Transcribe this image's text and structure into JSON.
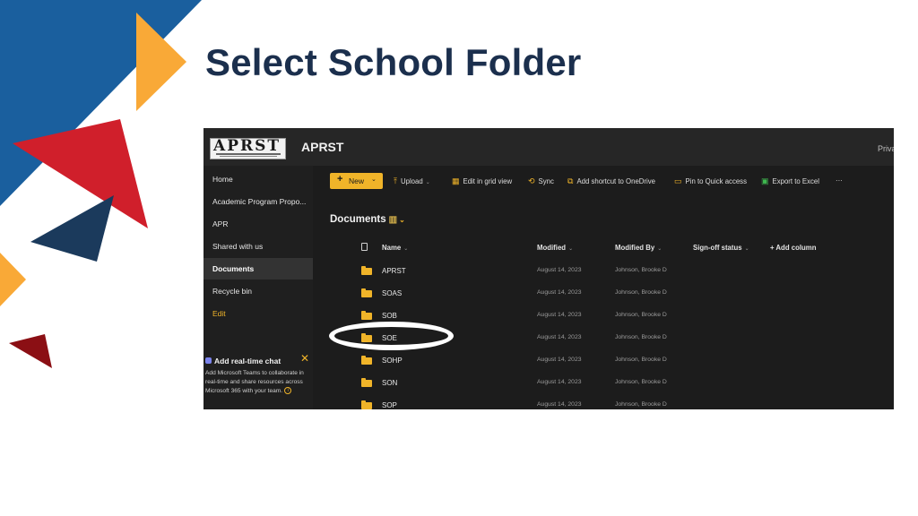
{
  "slide": {
    "title": "Select School Folder"
  },
  "colors": {
    "title": "#1b2f4d",
    "blue": "#1a5f9e",
    "orange": "#f9a937",
    "red": "#d01f2b",
    "navy": "#1b3a5c",
    "dark_red": "#8b0f14",
    "sp_background": "#1c1c1c",
    "accent_yellow": "#f0b429"
  },
  "sharepoint": {
    "logo_text": "APRST",
    "site_name": "APRST",
    "top_right_truncated": "Priva",
    "nav": [
      {
        "label": "Home"
      },
      {
        "label": "Academic Program Propo..."
      },
      {
        "label": "APR"
      },
      {
        "label": "Shared with us"
      },
      {
        "label": "Documents"
      },
      {
        "label": "Recycle bin"
      },
      {
        "label": "Edit"
      }
    ],
    "chat": {
      "title": "Add real-time chat",
      "body": "Add Microsoft Teams to collaborate in real-time and share resources across Microsoft 365 with your team.",
      "close_icon": "close-icon",
      "info_icon": "info-icon"
    },
    "commands": {
      "new": "New",
      "upload": "Upload",
      "edit_grid": "Edit in grid view",
      "sync": "Sync",
      "add_shortcut": "Add shortcut to OneDrive",
      "pin": "Pin to Quick access",
      "export": "Export to Excel",
      "more": "···"
    },
    "library": {
      "title": "Documents",
      "view_icon": "library-icon"
    },
    "columns": {
      "name": "Name",
      "modified": "Modified",
      "modified_by": "Modified By",
      "signoff": "Sign-off status",
      "add_column": "+ Add column"
    },
    "rows": [
      {
        "name": "APRST",
        "modified": "August 14, 2023",
        "modified_by": "Johnson, Brooke D"
      },
      {
        "name": "SOAS",
        "modified": "August 14, 2023",
        "modified_by": "Johnson, Brooke D"
      },
      {
        "name": "SOB",
        "modified": "August 14, 2023",
        "modified_by": "Johnson, Brooke D"
      },
      {
        "name": "SOE",
        "modified": "August 14, 2023",
        "modified_by": "Johnson, Brooke D"
      },
      {
        "name": "SOHP",
        "modified": "August 14, 2023",
        "modified_by": "Johnson, Brooke D"
      },
      {
        "name": "SON",
        "modified": "August 14, 2023",
        "modified_by": "Johnson, Brooke D"
      },
      {
        "name": "SOP",
        "modified": "August 14, 2023",
        "modified_by": "Johnson, Brooke D"
      }
    ],
    "highlighted_row": "SOE"
  }
}
